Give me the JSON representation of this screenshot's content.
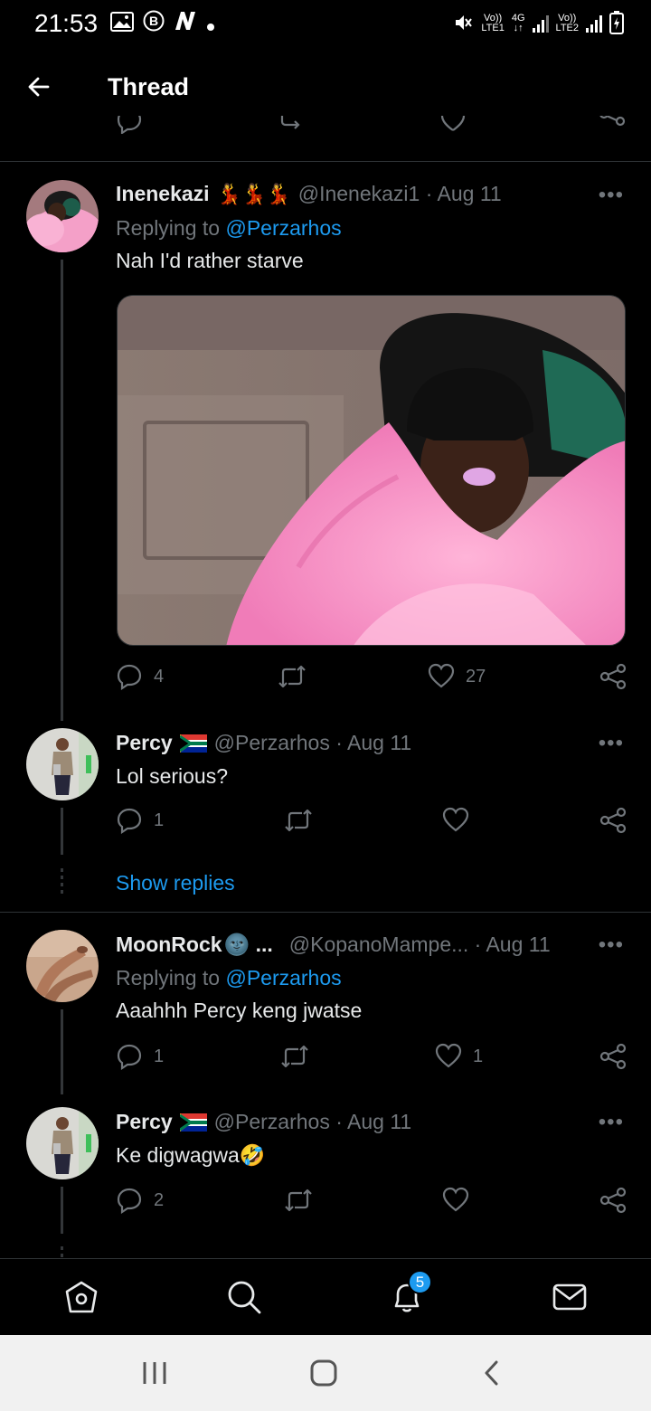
{
  "status_bar": {
    "time": "21:53",
    "net1_top": "Vo))",
    "net1_bottom": "LTE1",
    "net_type_top": "4G",
    "net_type_bottom": "↓↑",
    "net2_top": "Vo))",
    "net2_bottom": "LTE2"
  },
  "header": {
    "title": "Thread"
  },
  "tweets": [
    {
      "name": "Inenekazi",
      "emoji": "💃💃💃",
      "handle": "@Inenekazi1 · Aug 11",
      "replying_prefix": "Replying to ",
      "replying_to": "@Perzarhos",
      "text": "Nah I'd rather starve",
      "replies": "4",
      "retweets": "",
      "likes": "27"
    },
    {
      "name": "Percy",
      "handle": "@Perzarhos · Aug 11",
      "text": "Lol serious?",
      "replies": "1",
      "retweets": "",
      "likes": ""
    },
    {
      "name": "MoonRock",
      "emoji": "🌚 ...",
      "handle": "@KopanoMampe... · Aug 11",
      "replying_prefix": "Replying to ",
      "replying_to": "@Perzarhos",
      "text": "Aaahhh Percy keng jwatse",
      "replies": "1",
      "retweets": "",
      "likes": "1"
    },
    {
      "name": "Percy",
      "handle": "@Perzarhos · Aug 11",
      "text": "Ke digwagwa🤣",
      "replies": "2",
      "retweets": "",
      "likes": ""
    }
  ],
  "show_replies": "Show replies",
  "more_label": "•••",
  "bottom_nav": {
    "items": [
      "home-icon",
      "search-icon",
      "notifications-icon",
      "messages-icon"
    ],
    "notification_count": "5"
  },
  "colors": {
    "accent": "#1d9bf0",
    "background": "#000000",
    "muted": "#71767b",
    "divider": "#2f3336"
  }
}
